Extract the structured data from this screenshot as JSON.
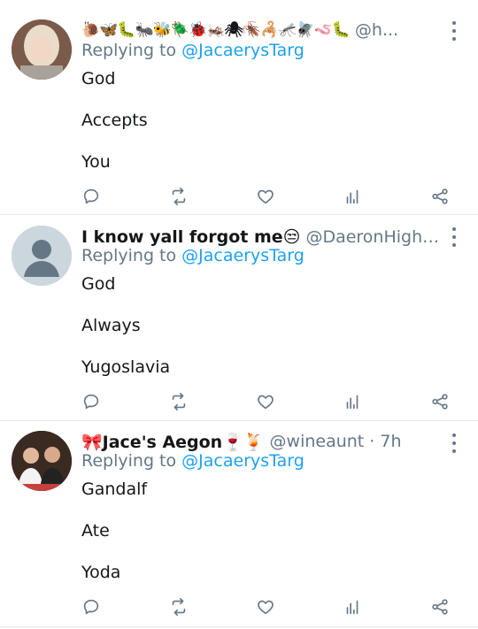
{
  "tweets": [
    {
      "name": "🐌🦋🐛🐜🐝🪲🐞🦗🕷🪳🦂🦟🪰🪱🐛",
      "handle": "@h...",
      "replying_prefix": "Replying to",
      "replying_to": "@JacaerysTarg",
      "lines": [
        "God",
        "Accepts",
        "You"
      ]
    },
    {
      "name": "I know yall forgot me😒",
      "handle": "@DaeronHighTarg ...",
      "replying_prefix": "Replying to",
      "replying_to": "@JacaerysTarg",
      "lines": [
        "God",
        "Always",
        "Yugoslavia"
      ]
    },
    {
      "name": "🎀Jace's Aegon🍷🍹",
      "handle": "@wineaunt · 7h",
      "replying_prefix": "Replying to",
      "replying_to": "@JacaerysTarg",
      "lines": [
        "Gandalf",
        "Ate",
        "Yoda"
      ]
    }
  ],
  "icons": {
    "reply": "comment-icon",
    "retweet": "retweet-icon",
    "like": "heart-icon",
    "analytics": "analytics-icon",
    "share": "share-icon",
    "more": "more-vertical-icon"
  },
  "colors": {
    "link": "#1da1f2",
    "secondary": "#657786",
    "text": "#14171a",
    "divider": "#e1e8ed"
  }
}
